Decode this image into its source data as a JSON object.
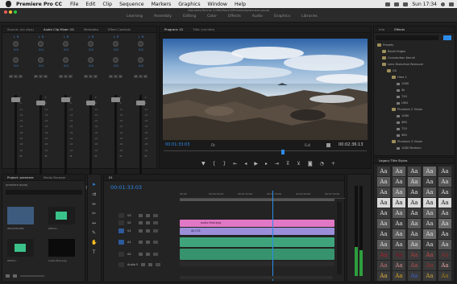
{
  "menubar": {
    "app_name": "Premiere Pro CC",
    "items": [
      "File",
      "Edit",
      "Clip",
      "Sequence",
      "Markers",
      "Graphics",
      "Window",
      "Help"
    ],
    "clock": "Sun 17:34"
  },
  "title": {
    "file_path": "/Volumes/Tecmix 2/360/MoryVi/Premiere/premiere.prproj",
    "workspaces": [
      "Learning",
      "Assembly",
      "Editing",
      "Color",
      "Effects",
      "Audio",
      "Graphics",
      "Libraries"
    ]
  },
  "source_tabs": [
    "Source: (no clips)",
    "Audio Clip Mixer: 01",
    "Metadata",
    "Effect Controls"
  ],
  "mixer": {
    "knob_value": "0.0",
    "lr_labels": [
      "L",
      "R"
    ],
    "buttons": [
      "M",
      "S",
      "R"
    ],
    "db_scale": [
      "-0",
      "-6",
      "-12",
      "-18",
      "-24",
      "-30",
      "-36",
      "-42",
      "-48",
      "-54",
      "dB"
    ],
    "channels": [
      {
        "id": "A1",
        "name": "Audio 1"
      },
      {
        "id": "A2",
        "name": "Audio 2"
      },
      {
        "id": "A3",
        "name": "Audio 3"
      },
      {
        "id": "A4",
        "name": "Audio 4"
      },
      {
        "id": "A5",
        "name": "Audio 5"
      },
      {
        "id": "",
        "name": "Audio 1"
      }
    ]
  },
  "program": {
    "tabs": [
      "Program: 01",
      "Title: (no title)"
    ],
    "timecode_current": "00:01:33:03",
    "fit_label": "Fit",
    "quality": "Full",
    "timecode_duration": "00:02:36:13"
  },
  "effects_panel": {
    "tabs": [
      "Info",
      "Effects"
    ],
    "tree": [
      {
        "label": "Presets",
        "indent": 0,
        "kind": "folder"
      },
      {
        "label": "Bevel Edges",
        "indent": 1,
        "kind": "folder"
      },
      {
        "label": "Convolution Kernel",
        "indent": 1,
        "kind": "folder"
      },
      {
        "label": "Lens Distortion Removal",
        "indent": 1,
        "kind": "folder"
      },
      {
        "label": "GS",
        "indent": 2,
        "kind": "folder"
      },
      {
        "label": "Hero 1",
        "indent": 3,
        "kind": "folder"
      },
      {
        "label": "1080",
        "indent": 4,
        "kind": "item"
      },
      {
        "label": "4k",
        "indent": 4,
        "kind": "item"
      },
      {
        "label": "720",
        "indent": 4,
        "kind": "item"
      },
      {
        "label": "UHD",
        "indent": 4,
        "kind": "item"
      },
      {
        "label": "Phantom 2 Vision",
        "indent": 3,
        "kind": "folder"
      },
      {
        "label": "1080",
        "indent": 4,
        "kind": "item"
      },
      {
        "label": "480",
        "indent": 4,
        "kind": "item"
      },
      {
        "label": "720",
        "indent": 4,
        "kind": "item"
      },
      {
        "label": "960",
        "indent": 4,
        "kind": "item"
      },
      {
        "label": "Phantom 3 Vision",
        "indent": 3,
        "kind": "folder"
      },
      {
        "label": "1080 Medium",
        "indent": 4,
        "kind": "item"
      }
    ],
    "legacy_title": "Legacy Title Styles",
    "style_glyph": "Aa"
  },
  "project": {
    "tabs": [
      "Project: premiere",
      "Media Browser"
    ],
    "file": "premiere.prproj",
    "items": [
      {
        "name": "IMG0236.MP4",
        "duration": "8:00"
      },
      {
        "name": "GP014...",
        "duration": "0:10:20:00"
      },
      {
        "name": "GP010...",
        "duration": "28:35:712"
      },
      {
        "name": "audio-final.png",
        "duration": ""
      }
    ]
  },
  "timeline": {
    "tab": "01",
    "timecode": "00:01:33:03",
    "ruler": [
      "00:00",
      "00:00:30:00",
      "00:01:00:00",
      "00:01:30:00",
      "00:02:00:00",
      "00:02:30:00"
    ],
    "tracks": [
      {
        "id": "V3"
      },
      {
        "id": "V2"
      },
      {
        "id": "V1"
      },
      {
        "id": "A1"
      },
      {
        "id": "A2"
      },
      {
        "id": "Audio 5"
      }
    ],
    "clip_title": "audio final.png",
    "clip_v1": "dji.CV1",
    "playhead_fraction": 0.6
  },
  "colors": {
    "accent_blue": "#2d8ceb",
    "clip_pink": "#e178c5",
    "clip_violet": "#9b8fd9",
    "clip_green": "#3fa47c",
    "title_gold": "#e0b23a"
  }
}
